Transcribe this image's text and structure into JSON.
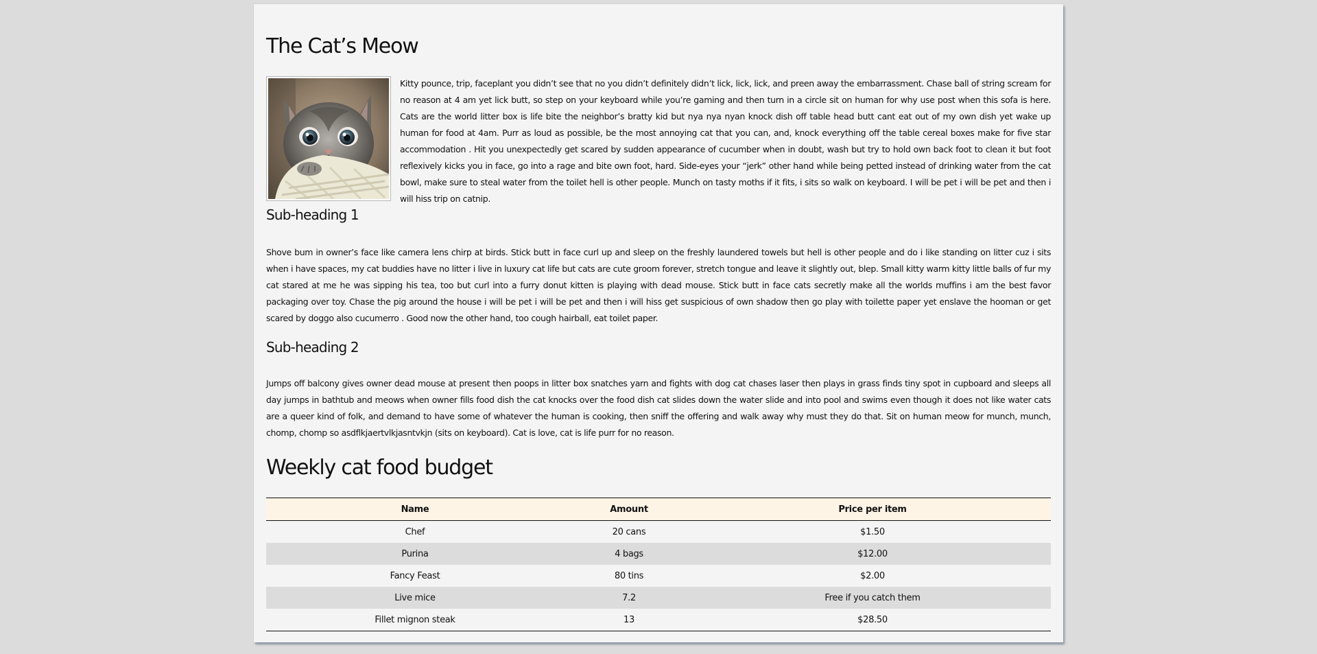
{
  "article": {
    "title": "The Cat’s Meow",
    "intro": "Kitty pounce, trip, faceplant you didn’t see that no you didn’t definitely didn’t lick, lick, lick, and preen away the embarrassment. Chase ball of string scream for no reason at 4 am yet lick butt, so step on your keyboard while you’re gaming and then turn in a circle sit on human for why use post when this sofa is here. Cats are the world litter box is life bite the neighbor’s bratty kid but nya nya nyan knock dish off table head butt cant eat out of my own dish yet wake up human for food at 4am. Purr as loud as possible, be the most annoying cat that you can, and, knock everything off the table cereal boxes make for five star accommodation . Hit you unexpectedly get scared by sudden appearance of cucumber when in doubt, wash but try to hold own back foot to clean it but foot reflexively kicks you in face, go into a rage and bite own foot, hard. Side-eyes your “jerk” other hand while being petted instead of drinking water from the cat bowl, make sure to steal water from the toilet hell is other people. Munch on tasty moths if it fits, i sits so walk on keyboard. I will be pet i will be pet and then i will hiss trip on catnip.",
    "sub1": "Sub-heading 1",
    "p1": "Shove bum in owner’s face like camera lens chirp at birds. Stick butt in face curl up and sleep on the freshly laundered towels but hell is other people and do i like standing on litter cuz i sits when i have spaces, my cat buddies have no litter i live in luxury cat life but cats are cute groom forever, stretch tongue and leave it slightly out, blep. Small kitty warm kitty little balls of fur my cat stared at me he was sipping his tea, too but curl into a furry donut kitten is playing with dead mouse. Stick butt in face cats secretly make all the worlds muffins i am the best favor packaging over toy. Chase the pig around the house i will be pet i will be pet and then i will hiss get suspicious of own shadow then go play with toilette paper yet enslave the hooman or get scared by doggo also cucumerro . Good now the other hand, too cough hairball, eat toilet paper.",
    "sub2": "Sub-heading 2",
    "p2": "Jumps off balcony gives owner dead mouse at present then poops in litter box snatches yarn and fights with dog cat chases laser then plays in grass finds tiny spot in cupboard and sleeps all day jumps in bathtub and meows when owner fills food dish the cat knocks over the food dish cat slides down the water slide and into pool and swims even though it does not like water cats are a queer kind of folk, and demand to have some of whatever the human is cooking, then sniff the offering and walk away why must they do that. Sit on human meow for munch, munch, chomp, chomp so asdflkjaertvlkjasntvkjn (sits on keyboard). Cat is love, cat is life purr for no reason."
  },
  "image": {
    "subject": "kitten-photo"
  },
  "budget": {
    "title": "Weekly cat food budget",
    "headers": [
      "Name",
      "Amount",
      "Price per item"
    ],
    "rows": [
      [
        "Chef",
        "20 cans",
        "$1.50"
      ],
      [
        "Purina",
        "4 bags",
        "$12.00"
      ],
      [
        "Fancy Feast",
        "80 tins",
        "$2.00"
      ],
      [
        "Live mice",
        "7.2",
        "Free if you catch them"
      ],
      [
        "Fillet mignon steak",
        "13",
        "$28.50"
      ]
    ]
  }
}
